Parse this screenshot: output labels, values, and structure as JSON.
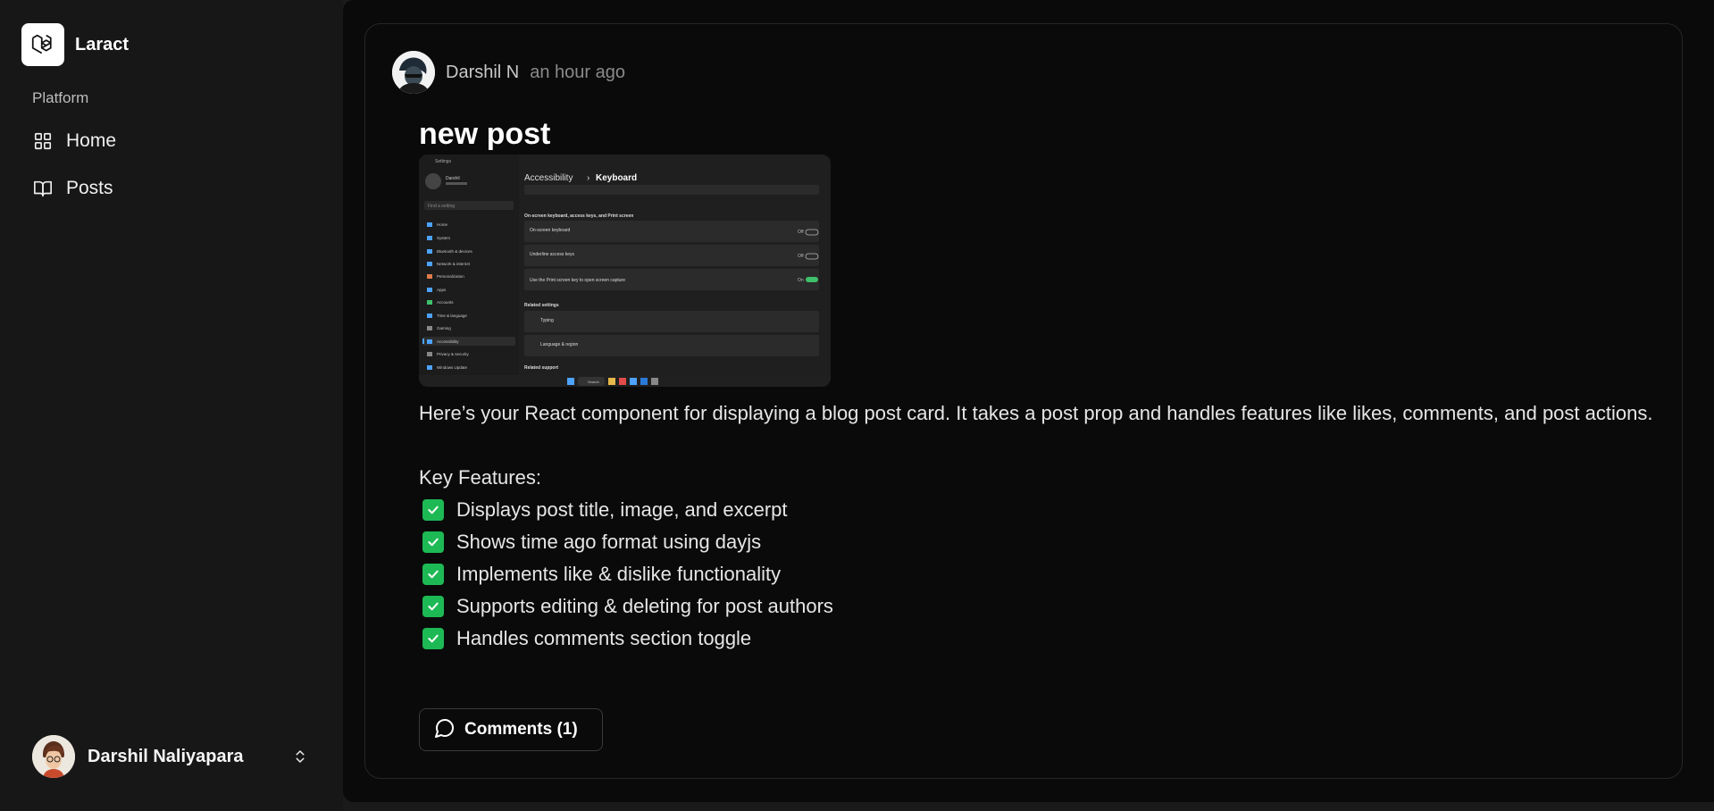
{
  "sidebar": {
    "brand": "Laract",
    "group_label": "Platform",
    "items": [
      {
        "label": "Home",
        "icon": "grid-icon"
      },
      {
        "label": "Posts",
        "icon": "book-open-icon"
      }
    ],
    "user": {
      "name": "Darshil Naliyapara",
      "menu_icon": "chevrons-up-down-icon"
    }
  },
  "post": {
    "author": "Darshil N",
    "time_ago": "an hour ago",
    "title": "new post",
    "image": {
      "description": "Windows Settings screenshot",
      "app_name": "Settings",
      "breadcrumb_parent": "Accessibility",
      "breadcrumb_current": "Keyboard",
      "section_1": "On-screen keyboard, access keys, and Print screen",
      "section_2": "Related settings",
      "section_3": "Related support",
      "rows": [
        {
          "title": "On-screen keyboard",
          "state": "Off"
        },
        {
          "title": "Underline access keys",
          "state": "Off"
        },
        {
          "title": "Use the Print screen key to open screen capture",
          "state": "On"
        }
      ],
      "related": [
        "Typing",
        "Language & region"
      ],
      "profile_name": "Darshil",
      "search_placeholder": "Find a setting",
      "nav": [
        "Home",
        "System",
        "Bluetooth & devices",
        "Network & internet",
        "Personalization",
        "Apps",
        "Accounts",
        "Time & language",
        "Gaming",
        "Accessibility",
        "Privacy & security",
        "Windows Update"
      ],
      "taskbar_search": "Search"
    },
    "intro": "Here’s your React component for displaying a blog post card. It takes a post prop and handles features like likes, comments, and post actions.",
    "features_heading": "Key Features:",
    "features": [
      "Displays post title, image, and excerpt",
      "Shows time ago format using dayjs",
      "Implements like & dislike functionality",
      "Supports editing & deleting for post authors",
      "Handles comments section toggle"
    ],
    "comments_label": "Comments (1)"
  },
  "colors": {
    "accent_check": "#1db954",
    "background": "#0a0a0a",
    "sidebar": "#171717"
  }
}
